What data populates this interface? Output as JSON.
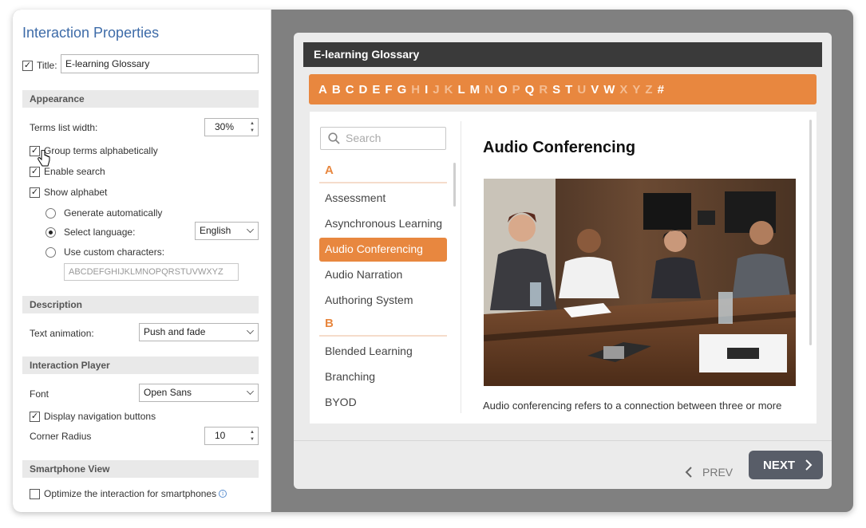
{
  "panel": {
    "title": "Interaction Properties",
    "title_label": "Title:",
    "title_value": "E-learning Glossary",
    "appearance_header": "Appearance",
    "terms_width_label": "Terms list width:",
    "terms_width_value": "30%",
    "group_terms_label": "Group terms alphabetically",
    "enable_search_label": "Enable search",
    "show_alphabet_label": "Show alphabet",
    "generate_auto_label": "Generate automatically",
    "select_language_label": "Select language:",
    "language_value": "English",
    "custom_chars_label": "Use custom characters:",
    "custom_chars_value": "ABCDEFGHIJKLMNOPQRSTUVWXYZ",
    "description_header": "Description",
    "text_animation_label": "Text animation:",
    "text_animation_value": "Push and fade",
    "player_header": "Interaction Player",
    "font_label": "Font",
    "font_value": "Open Sans",
    "display_nav_label": "Display navigation buttons",
    "corner_radius_label": "Corner Radius",
    "corner_radius_value": "10",
    "smartphone_header": "Smartphone View",
    "optimize_label": "Optimize the interaction for smartphones"
  },
  "player": {
    "title": "E-learning Glossary",
    "alphabet": [
      {
        "ch": "A",
        "on": true
      },
      {
        "ch": "B",
        "on": true
      },
      {
        "ch": "C",
        "on": true
      },
      {
        "ch": "D",
        "on": true
      },
      {
        "ch": "E",
        "on": true
      },
      {
        "ch": "F",
        "on": true
      },
      {
        "ch": "G",
        "on": true
      },
      {
        "ch": "H",
        "on": false
      },
      {
        "ch": "I",
        "on": true
      },
      {
        "ch": "J",
        "on": false
      },
      {
        "ch": "K",
        "on": false
      },
      {
        "ch": "L",
        "on": true
      },
      {
        "ch": "M",
        "on": true
      },
      {
        "ch": "N",
        "on": false
      },
      {
        "ch": "O",
        "on": true
      },
      {
        "ch": "P",
        "on": false
      },
      {
        "ch": "Q",
        "on": true
      },
      {
        "ch": "R",
        "on": false
      },
      {
        "ch": "S",
        "on": true
      },
      {
        "ch": "T",
        "on": true
      },
      {
        "ch": "U",
        "on": false
      },
      {
        "ch": "V",
        "on": true
      },
      {
        "ch": "W",
        "on": true
      },
      {
        "ch": "X",
        "on": false
      },
      {
        "ch": "Y",
        "on": false
      },
      {
        "ch": "Z",
        "on": false
      },
      {
        "ch": "#",
        "on": true
      }
    ],
    "search_placeholder": "Search",
    "groups": [
      {
        "letter": "A",
        "terms": [
          "Assessment",
          "Asynchronous Learning",
          "Audio Conferencing",
          "Audio Narration",
          "Authoring System"
        ]
      },
      {
        "letter": "B",
        "terms": [
          "Blended Learning",
          "Branching",
          "BYOD"
        ]
      }
    ],
    "active_term": "Audio Conferencing",
    "term_title": "Audio Conferencing",
    "term_text": "Audio conferencing refers to a connection between three or more",
    "prev_label": "PREV",
    "next_label": "NEXT"
  },
  "colors": {
    "accent": "#e8873f",
    "title_blue": "#3d6ba8",
    "next_button": "#585d68"
  },
  "icons": {
    "search": "search-icon",
    "info": "info-icon",
    "prev": "chevron-left-icon",
    "next": "chevron-right-icon",
    "cursor": "hand-cursor-icon"
  }
}
